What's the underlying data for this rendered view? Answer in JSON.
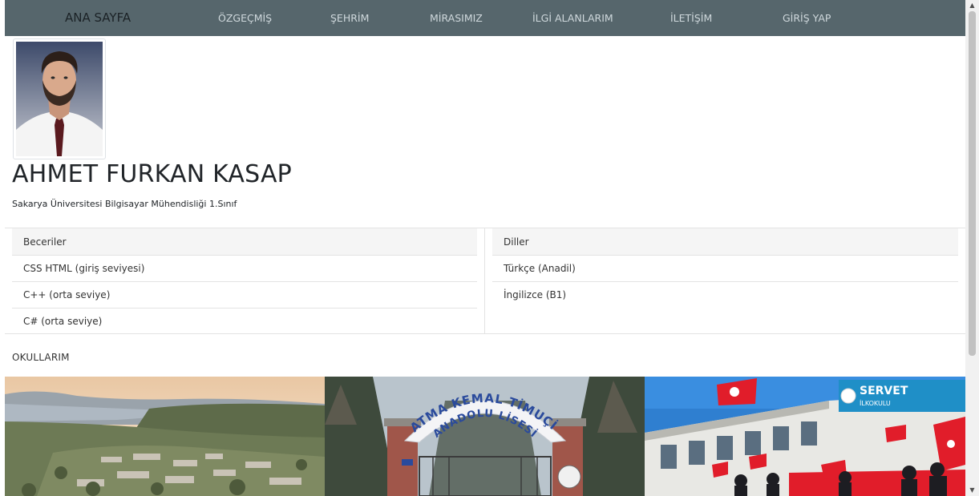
{
  "nav": {
    "brand": "ANA SAYFA",
    "items": [
      "ÖZGEÇMİŞ",
      "ŞEHRİM",
      "MİRASIMIZ",
      "İLGİ ALANLARIM",
      "İLETİŞİM",
      "GİRİŞ YAP"
    ]
  },
  "profile": {
    "name": "AHMET FURKAN KASAP",
    "subtitle": "Sakarya Üniversitesi Bilgisayar Mühendisliği 1.Sınıf"
  },
  "skills": {
    "header": "Beceriler",
    "items": [
      "CSS HTML (giriş seviyesi)",
      "C++ (orta seviye)",
      "C# (orta seviye)"
    ]
  },
  "languages": {
    "header": "Diller",
    "items": [
      "Türkçe (Anadil)",
      "İngilizce (B1)"
    ]
  },
  "schools": {
    "title": "OKULLARIM",
    "arch_text_top": "FATMA KEMAL TİMUÇİN",
    "arch_text_bottom": "ANADOLU LİSESİ",
    "sign_text": "SERVET",
    "sign_sub": "İLKOKULU"
  },
  "colors": {
    "navbar": "#56666c",
    "nav_text": "#cfd8dc",
    "nav_brand": "#1b2226"
  }
}
